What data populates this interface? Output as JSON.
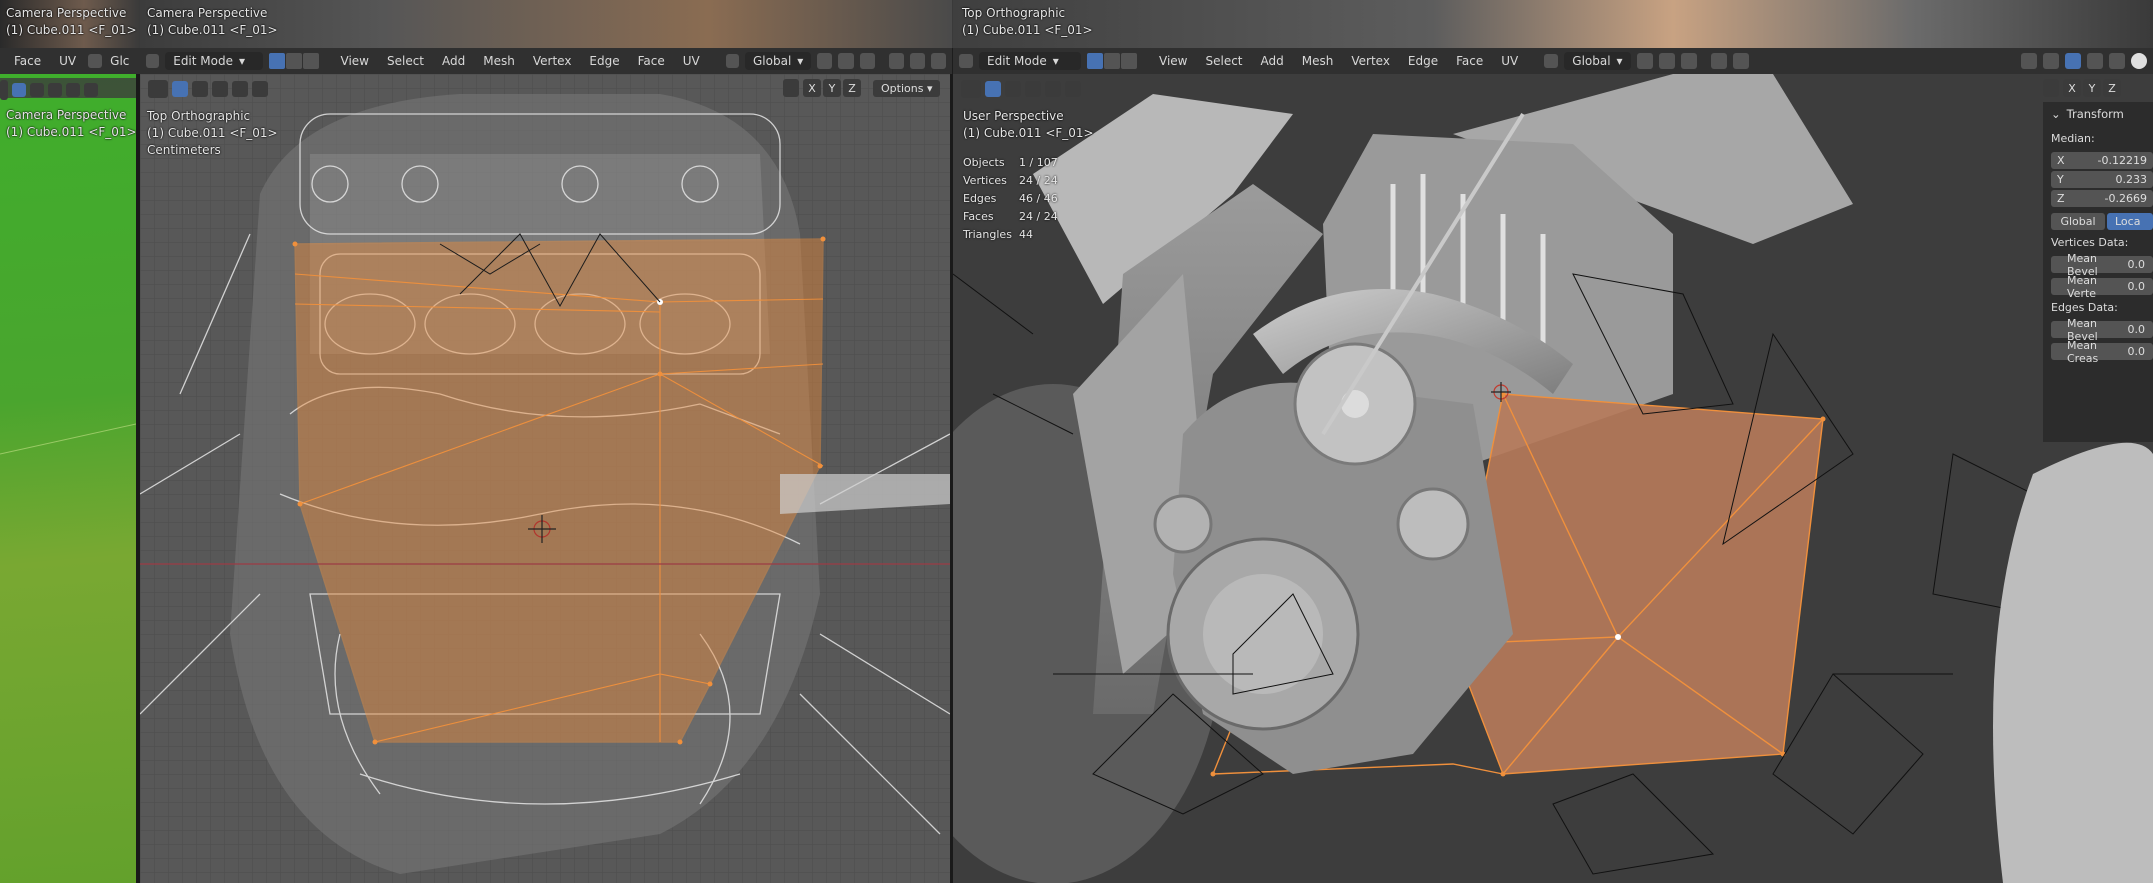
{
  "top_strip": {
    "left_small": {
      "title": "Camera Perspective",
      "object": "(1) Cube.011 <F_01>"
    },
    "left_main": {
      "title": "Camera Perspective",
      "object": "(1) Cube.011 <F_01>"
    },
    "right": {
      "title": "Top Orthographic",
      "object": "(1) Cube.011 <F_01>"
    }
  },
  "header_left": {
    "menus": [
      "Face",
      "UV"
    ],
    "global_partial": "Glc"
  },
  "header_mid": {
    "mode": "Edit Mode",
    "menus": [
      "View",
      "Select",
      "Add",
      "Mesh",
      "Vertex",
      "Edge",
      "Face",
      "UV"
    ],
    "orientation": "Global",
    "options": "Options"
  },
  "header_right": {
    "mode": "Edit Mode",
    "menus": [
      "View",
      "Select",
      "Add",
      "Mesh",
      "Vertex",
      "Edge",
      "Face",
      "UV"
    ],
    "orientation": "Global"
  },
  "viewport_left": {
    "title": "Camera Perspective",
    "object": "(1) Cube.011 <F_01>"
  },
  "viewport_mid": {
    "title": "Top Orthographic",
    "object": "(1) Cube.011 <F_01>",
    "units": "Centimeters",
    "axes": [
      "X",
      "Y",
      "Z"
    ]
  },
  "viewport_right": {
    "title": "User Perspective",
    "object": "(1) Cube.011 <F_01>",
    "axes": [
      "X",
      "Y",
      "Z"
    ],
    "stats": [
      {
        "k": "Objects",
        "v": "1 / 107"
      },
      {
        "k": "Vertices",
        "v": "24 / 24"
      },
      {
        "k": "Edges",
        "v": "46 / 46"
      },
      {
        "k": "Faces",
        "v": "24 / 24"
      },
      {
        "k": "Triangles",
        "v": "44"
      }
    ]
  },
  "npanel": {
    "section": "Transform",
    "median_label": "Median:",
    "x": {
      "axis": "X",
      "value": "-0.12219"
    },
    "y": {
      "axis": "Y",
      "value": "0.233"
    },
    "z": {
      "axis": "Z",
      "value": "-0.2669"
    },
    "global": "Global",
    "local": "Loca",
    "vertices_data": "Vertices Data:",
    "mean_bevel_v": "Mean Bevel",
    "mean_bevel_v_val": "0.0",
    "mean_vertex": "Mean Verte",
    "mean_vertex_val": "0.0",
    "edges_data": "Edges Data:",
    "mean_bevel_e": "Mean Bevel",
    "mean_bevel_e_val": "0.0",
    "mean_crease": "Mean Creas",
    "mean_crease_val": "0.0"
  },
  "colors": {
    "header": "#303030",
    "green": "#4fa52e",
    "mesh_orange": "#e8893a",
    "blue_accent": "#4772b3"
  }
}
